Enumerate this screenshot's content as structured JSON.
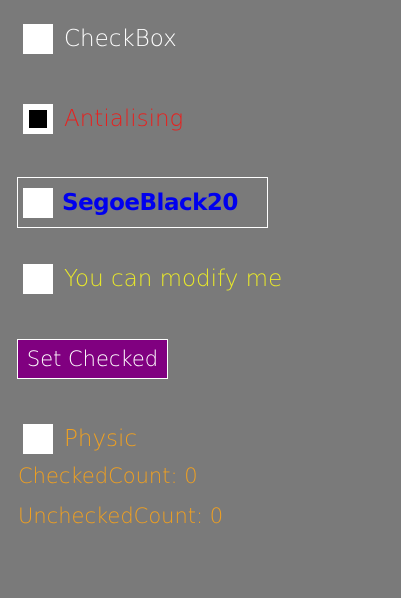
{
  "colors": {
    "background": "#7a7a7a",
    "checkbox_fill": "#ffffff",
    "antialising_label": "#e8201e",
    "segoe_label": "#0000ee",
    "modify_label": "#e8e82a",
    "button_bg": "#800080",
    "orange_text": "#f0a020"
  },
  "checkboxes": [
    {
      "label": "CheckBox",
      "checked": false
    },
    {
      "label": "Antialising",
      "checked": true
    },
    {
      "label": "SegoeBlack20",
      "checked": false
    },
    {
      "label": "You can modify me",
      "checked": false
    },
    {
      "label": "Physic",
      "checked": false
    }
  ],
  "button": {
    "label": "Set Checked"
  },
  "counts": {
    "checked": "CheckedCount: 0",
    "unchecked": "UncheckedCount: 0"
  }
}
